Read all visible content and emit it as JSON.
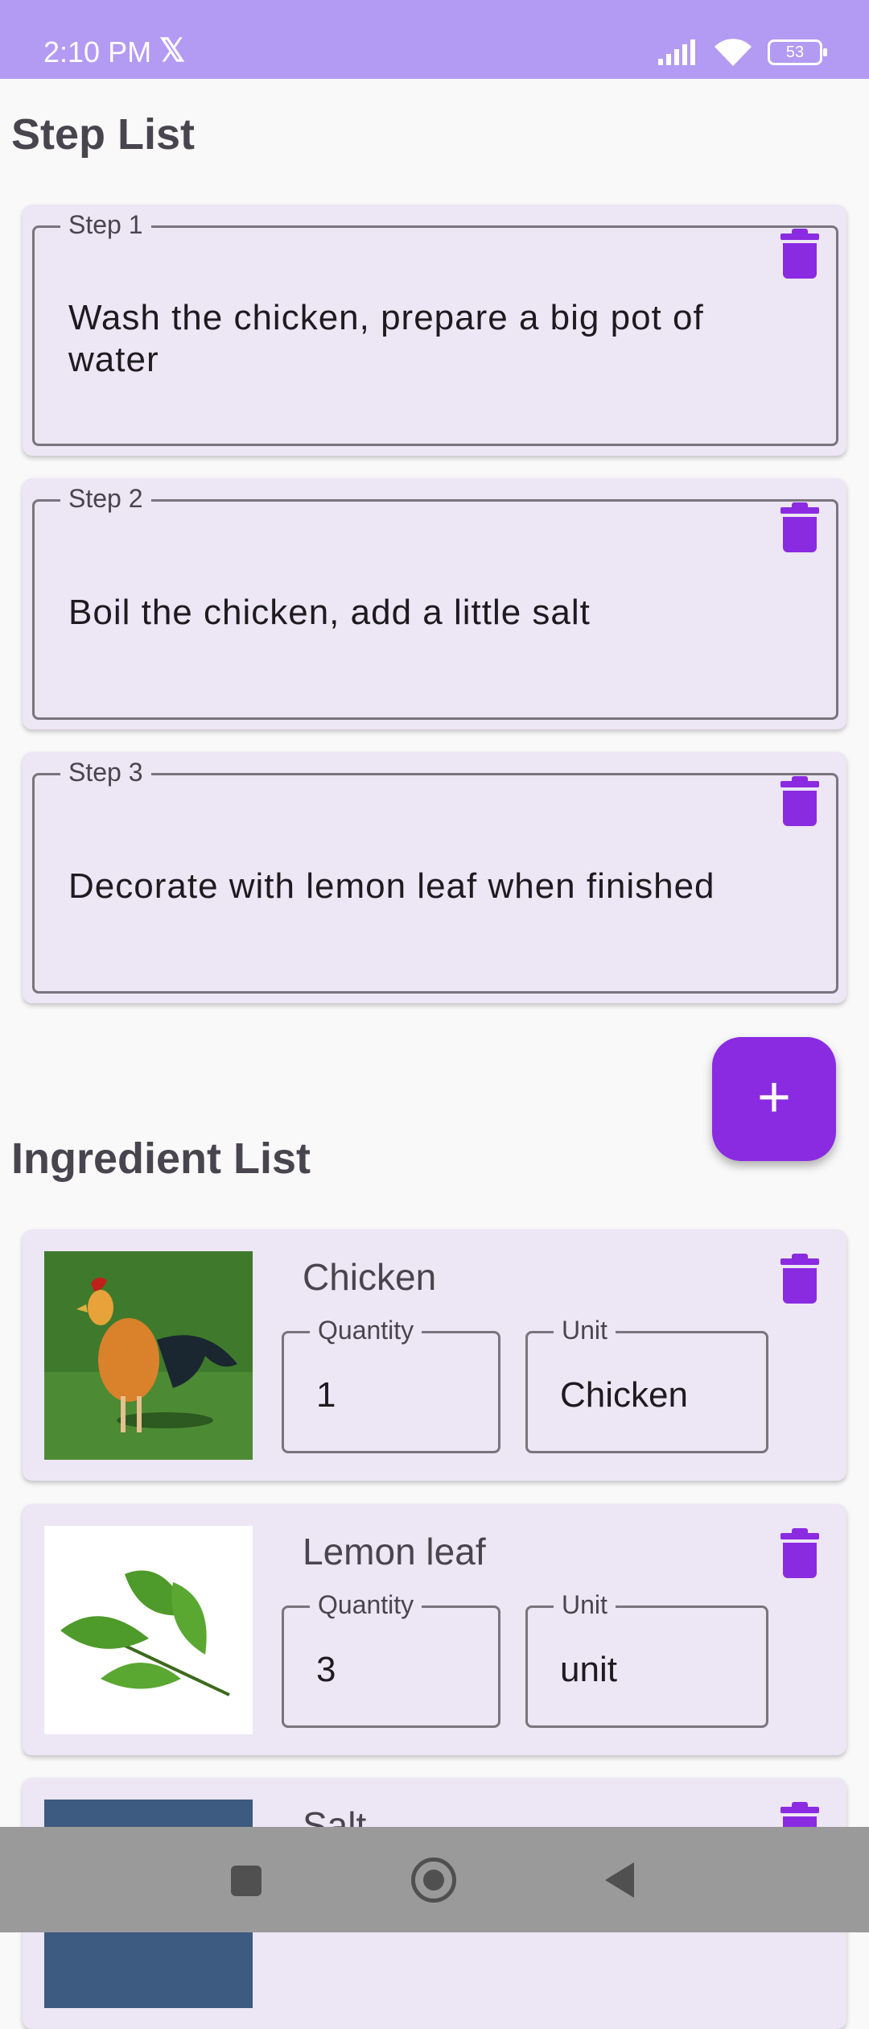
{
  "status": {
    "time": "2:10 PM",
    "x_glyph": "𝕏",
    "battery": "53"
  },
  "sections": {
    "steps_title": "Step List",
    "ingredients_title": "Ingredient List"
  },
  "steps": [
    {
      "label": "Step 1",
      "text": "Wash the chicken, prepare a big pot of water"
    },
    {
      "label": "Step 2",
      "text": "Boil the chicken, add a little salt"
    },
    {
      "label": "Step 3",
      "text": "Decorate with lemon leaf when finished"
    }
  ],
  "fab": {
    "glyph": "+"
  },
  "ingredients": [
    {
      "name": "Chicken",
      "quantity_label": "Quantity",
      "quantity": "1",
      "unit_label": "Unit",
      "unit": "Chicken"
    },
    {
      "name": "Lemon leaf",
      "quantity_label": "Quantity",
      "quantity": "3",
      "unit_label": "Unit",
      "unit": "unit"
    },
    {
      "name": "Salt"
    }
  ],
  "colors": {
    "accent": "#8a2be2",
    "status_bar": "#b39af2",
    "card": "#ede6f4"
  },
  "icons": {
    "delete": "trash-icon",
    "add": "plus-icon"
  }
}
